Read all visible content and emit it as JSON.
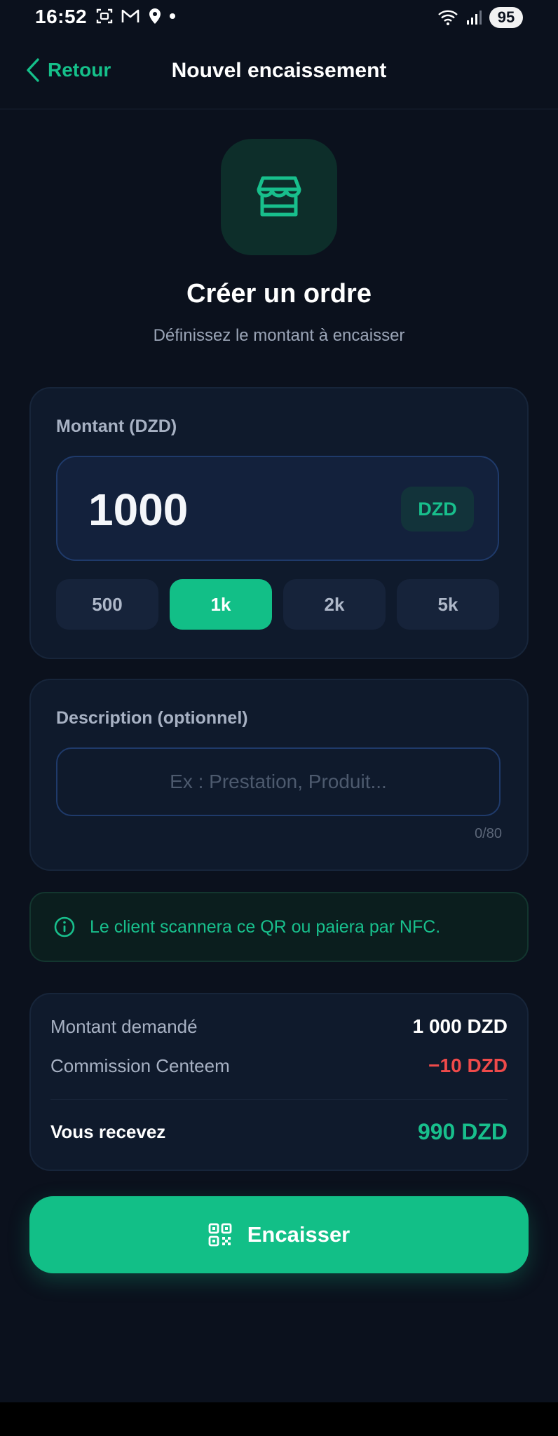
{
  "status_bar": {
    "time": "16:52",
    "battery": "95",
    "icons_left": [
      "screenshot-icon",
      "gmail-icon",
      "location-icon"
    ],
    "icons_right": [
      "wifi-icon",
      "signal-icon"
    ]
  },
  "header": {
    "back_label": "Retour",
    "title": "Nouvel encaissement"
  },
  "hero": {
    "icon": "store-icon",
    "title": "Créer un ordre",
    "subtitle": "Définissez le montant à encaisser"
  },
  "amount_card": {
    "label": "Montant (DZD)",
    "value": "1000",
    "currency": "DZD",
    "quick_amounts": [
      {
        "label": "500",
        "active": false
      },
      {
        "label": "1k",
        "active": true
      },
      {
        "label": "2k",
        "active": false
      },
      {
        "label": "5k",
        "active": false
      }
    ]
  },
  "description_card": {
    "label": "Description (optionnel)",
    "placeholder": "Ex : Prestation, Produit...",
    "value": "",
    "counter": "0/80"
  },
  "info": {
    "text": "Le client scannera ce QR ou paiera par NFC."
  },
  "summary": {
    "requested_label": "Montant demandé",
    "requested_value": "1 000 DZD",
    "commission_label": "Commission Centeem",
    "commission_value": "−10 DZD",
    "receive_label": "Vous recevez",
    "receive_value": "990 DZD"
  },
  "cta": {
    "label": "Encaisser",
    "icon": "qr-code-icon"
  },
  "colors": {
    "background": "#0b111d",
    "accent": "#12bf87",
    "card": "#0f1a2c",
    "danger": "#ef4a4a"
  }
}
